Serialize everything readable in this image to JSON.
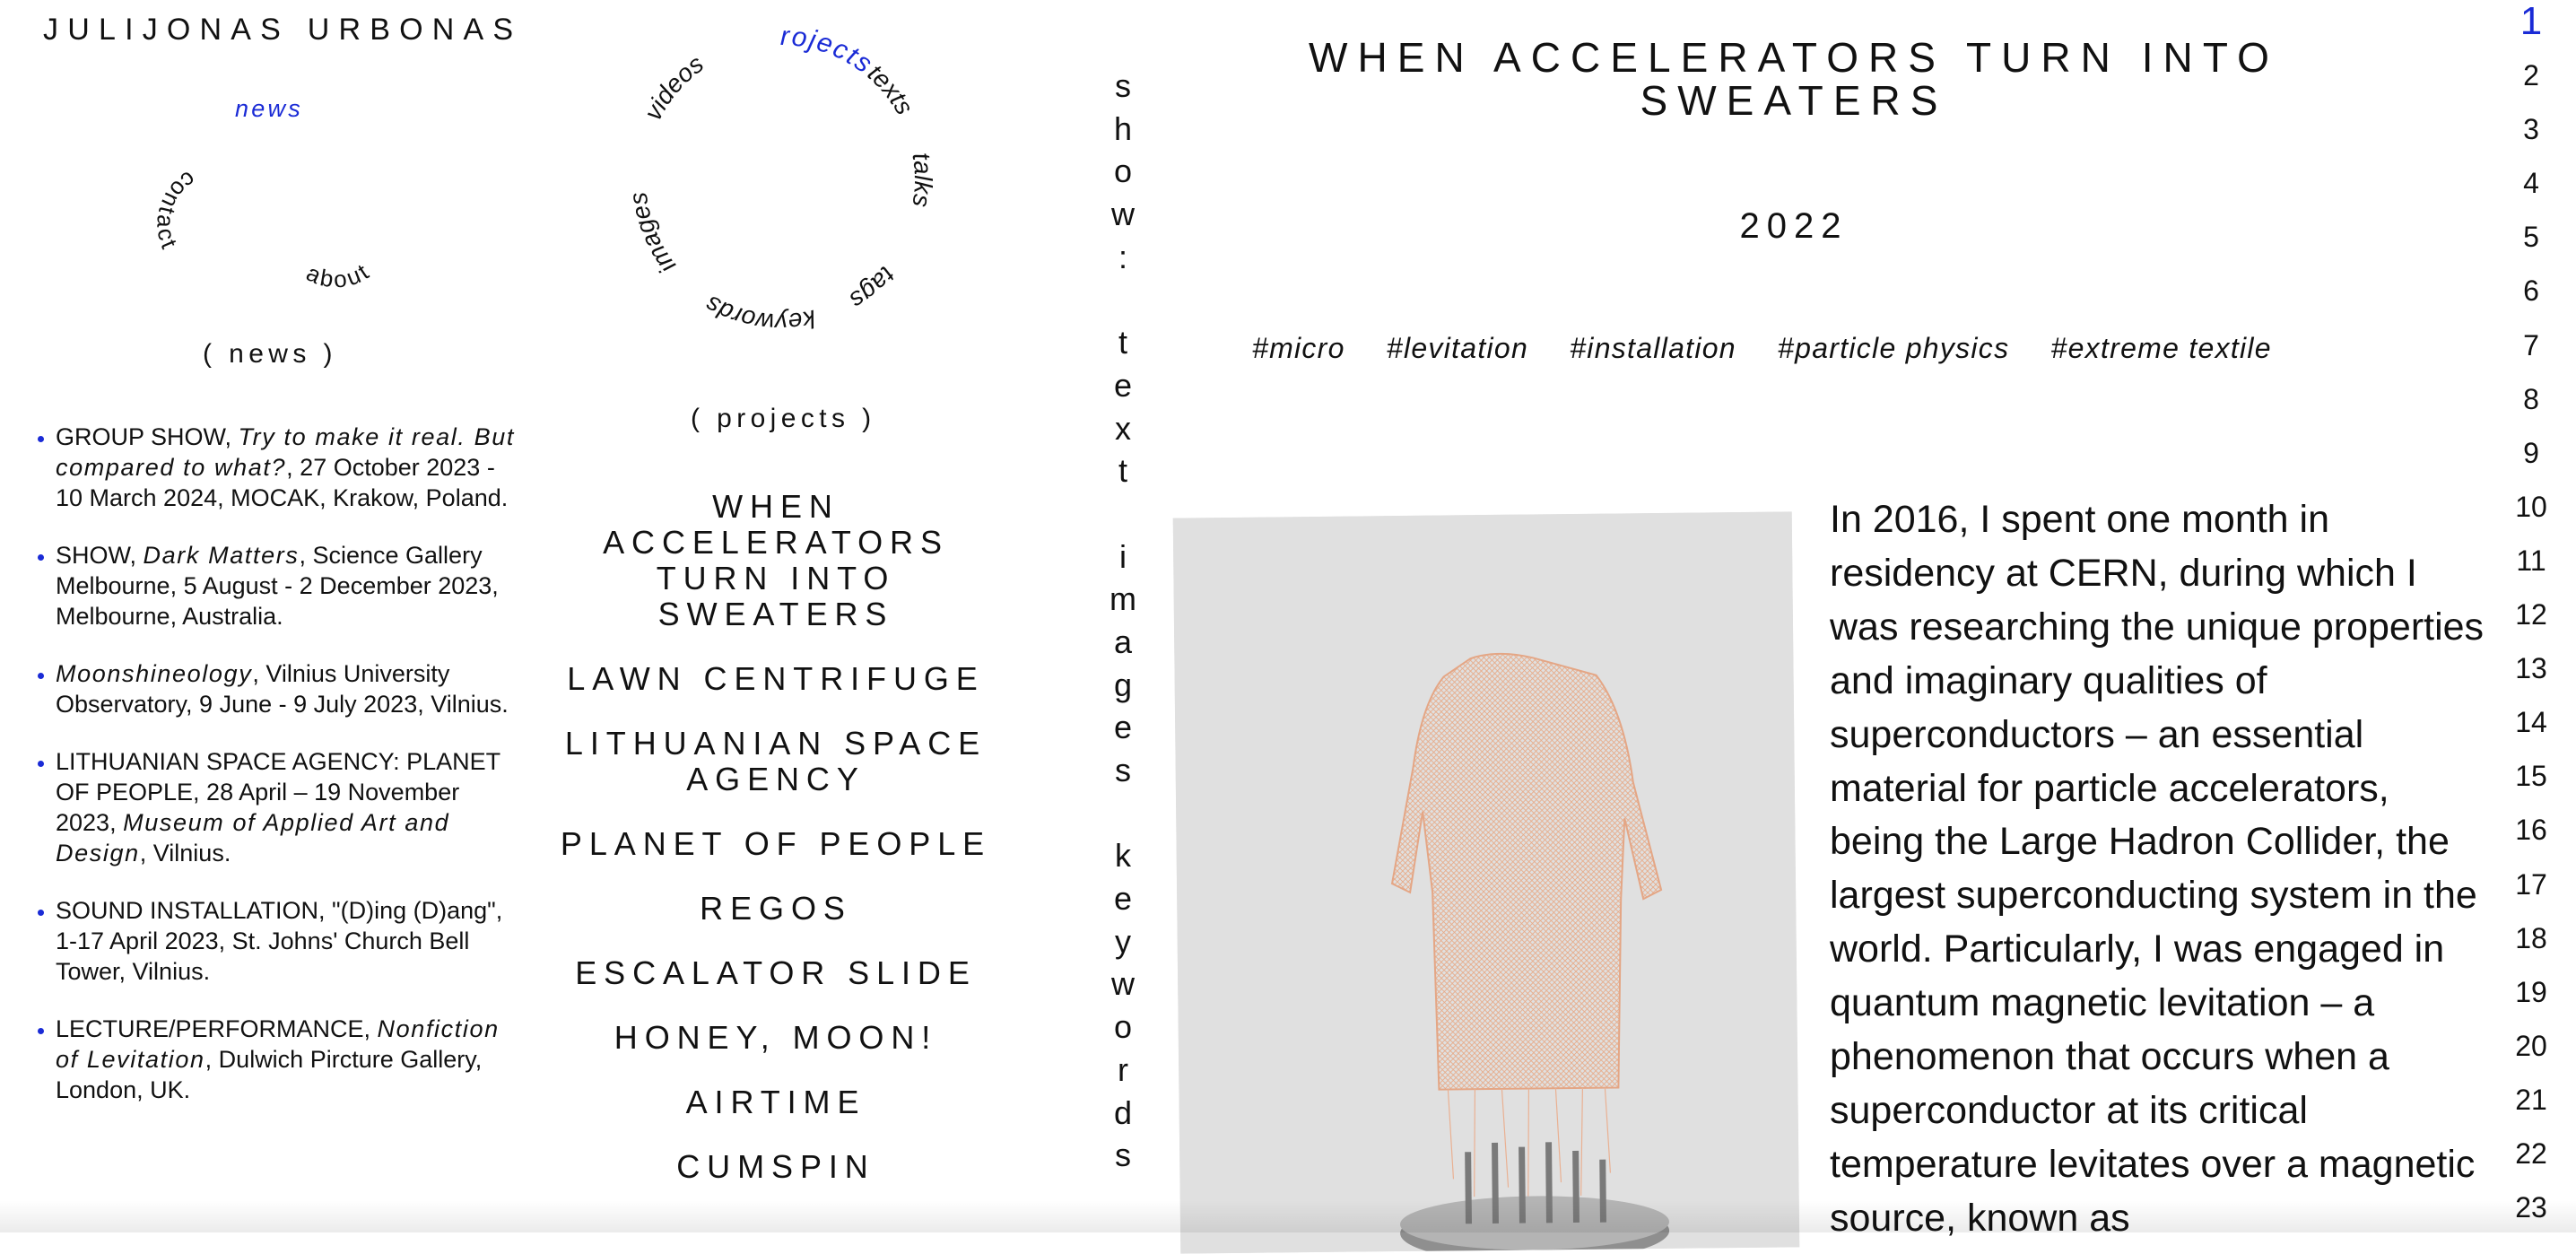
{
  "site": {
    "title": "JULIJONAS URBONAS",
    "news_link": "news",
    "nav_small": {
      "about": "about",
      "contact": "contact"
    }
  },
  "nav_circle": {
    "projects": "projects",
    "videos": "videos",
    "texts": "texts",
    "talks": "talks",
    "tags": "tags",
    "keywords": "keywords",
    "images": "images"
  },
  "sections": {
    "news": "( news )",
    "projects": "( projects )"
  },
  "news": [
    {
      "title": "GROUP SHOW, ",
      "highlight": "Try to make it real. But compared to what?",
      "details": ", 27 October 2023 - 10 March 2024, MOCAK, Krakow, Poland."
    },
    {
      "title": "SHOW, ",
      "highlight": "Dark Matters",
      "details": ", Science Gallery Melbourne, 5 August - 2 December 2023, Melbourne, Australia."
    },
    {
      "title": "",
      "highlight": "Moonshineology",
      "details": ", Vilnius University Observatory, 9 June - 9 July 2023, Vilnius."
    },
    {
      "title": "LITHUANIAN SPACE AGENCY: PLANET OF PEOPLE, 28 April – 19 November 2023, ",
      "highlight": "Museum of Applied Art and Design",
      "details": ", Vilnius."
    },
    {
      "title": "SOUND INSTALLATION, \"(D)ing (D)ang\", 1-17 April 2023, St. Johns' Church Bell Tower, Vilnius.",
      "highlight": "",
      "details": ""
    },
    {
      "title": "LECTURE/PERFORMANCE, ",
      "highlight": "Nonfiction of Levitation",
      "details": ", Dulwich Pircture Gallery, London, UK."
    }
  ],
  "projects": [
    "WHEN ACCELERATORS TURN INTO SWEATERS",
    "LAWN CENTRIFUGE",
    "LITHUANIAN SPACE AGENCY",
    "PLANET OF PEOPLE",
    "REGOS",
    "ESCALATOR SLIDE",
    "HONEY, MOON!",
    "AIRTIME",
    "CUMSPIN"
  ],
  "vertical_nav": {
    "show": "show:",
    "text": "text",
    "images": "images",
    "keywords": "keywords"
  },
  "article": {
    "title": "WHEN ACCELERATORS TURN INTO SWEATERS",
    "year": "2022",
    "tags": [
      "#micro",
      "#levitation",
      "#installation",
      "#particle physics",
      "#extreme textile"
    ],
    "body": "In 2016, I spent one month in residency at CERN, during which I was researching the unique properties and imaginary qualities of superconductors – an essential material for particle accelerators, being the Large Hadron Collider, the largest superconducting system in the world. Particularly, I was engaged in quantum magnetic levitation – a phenomenon that occurs when a superconductor at its critical temperature levitates over a magnetic source, known as"
  },
  "line_numbers": [
    "1",
    "2",
    "3",
    "4",
    "5",
    "6",
    "7",
    "8",
    "9",
    "10",
    "11",
    "12",
    "13",
    "14",
    "15",
    "16",
    "17",
    "18",
    "19",
    "20",
    "21",
    "22",
    "23"
  ],
  "colors": {
    "accent": "#1a2bd6",
    "text": "#111111",
    "image_bg": "#e0e0e0",
    "sweater": "#e8a27a"
  }
}
